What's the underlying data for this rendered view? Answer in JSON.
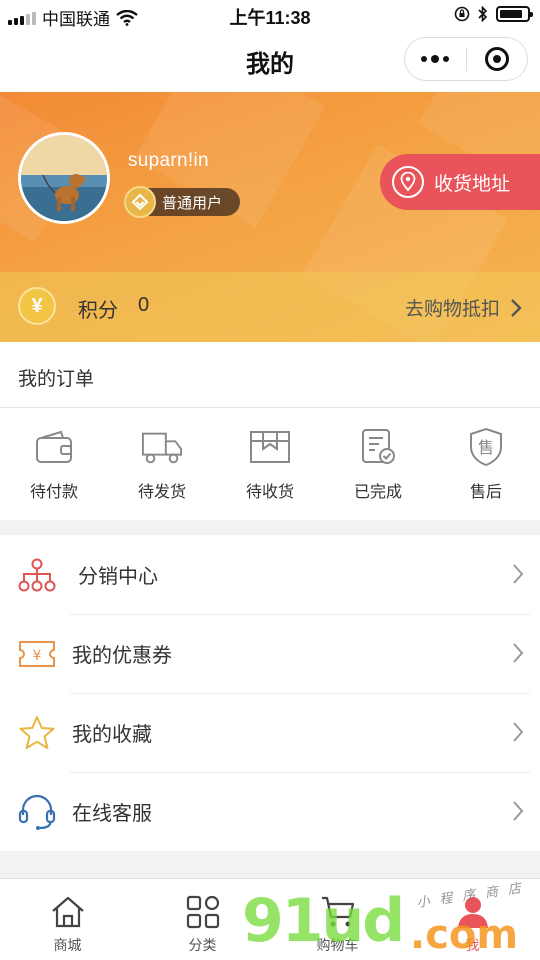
{
  "status_bar": {
    "carrier": "中国联通",
    "time": "上午11:38"
  },
  "nav": {
    "title": "我的",
    "more_icon": "more-dots-icon",
    "close_icon": "target-circle-icon"
  },
  "profile": {
    "username": "suparn!in",
    "level_badge": "普通用户",
    "address_button": "收货地址",
    "points_label": "积分",
    "points_value": "0",
    "points_symbol": "¥",
    "deduct_link": "去购物抵扣"
  },
  "orders": {
    "title": "我的订单",
    "items": [
      {
        "label": "待付款",
        "icon": "wallet-icon"
      },
      {
        "label": "待发货",
        "icon": "truck-icon"
      },
      {
        "label": "待收货",
        "icon": "package-icon"
      },
      {
        "label": "已完成",
        "icon": "completed-document-icon"
      },
      {
        "label": "售后",
        "icon": "after-sale-shield-icon"
      }
    ]
  },
  "menu": {
    "items": [
      {
        "label": "分销中心",
        "icon": "distribution-network-icon"
      },
      {
        "label": "我的优惠券",
        "icon": "coupon-icon"
      },
      {
        "label": "我的收藏",
        "icon": "star-icon"
      },
      {
        "label": "在线客服",
        "icon": "headset-icon"
      }
    ]
  },
  "tab_bar": {
    "items": [
      {
        "label": "商城",
        "icon": "home-icon"
      },
      {
        "label": "分类",
        "icon": "category-grid-icon"
      },
      {
        "label": "购物车",
        "icon": "cart-icon"
      },
      {
        "label": "我",
        "icon": "user-icon",
        "active": true
      }
    ]
  },
  "watermark": {
    "main": "91ud",
    "suffix": ".com",
    "handwriting": "小程序商店"
  },
  "colors": {
    "header_gradient_start": "#f28a36",
    "header_gradient_end": "#f6b654",
    "accent_red": "#e9545a",
    "badge_gold": "#e8b648"
  },
  "battery_level": 0.85
}
